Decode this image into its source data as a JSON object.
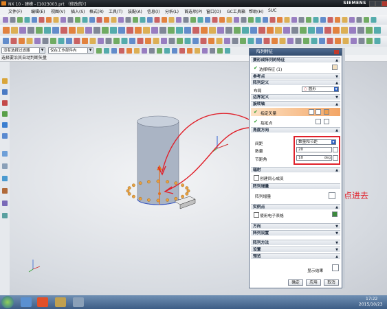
{
  "window": {
    "title": "NX 10 - 建模 - [1023003.prt （修改的）]",
    "brand": "SIEMENS"
  },
  "menu": [
    "文件(F)",
    "编辑(E)",
    "视图(V)",
    "插入(S)",
    "格式(R)",
    "工具(T)",
    "装配(A)",
    "信息(I)",
    "分析(L)",
    "首选项(P)",
    "窗口(O)",
    "GC工具箱",
    "帮助(H)",
    "SUC"
  ],
  "selection_bar": {
    "filter": "没有选择过滤器",
    "scope": "仅在工作部件内"
  },
  "cue_line": "选择要沿其自动判断矢量",
  "dialog": {
    "title": "阵列特征",
    "sec_features": "要形成阵列的特征",
    "select_feature": "选择特征 (1)",
    "sec_ref_point": "参考点",
    "sec_pattern_def": "阵列定义",
    "layout_label": "布局",
    "layout_value": "圆形",
    "sec_boundary": "边界定义",
    "sec_rotation_axis": "旋转轴",
    "specify_vector": "指定矢量",
    "specify_point": "指定点",
    "sec_angular_dir": "角度方向",
    "spacing_label": "间距",
    "spacing_value": "数量和节距",
    "count_label": "数量",
    "count_value": "20",
    "pitch_label": "节距角",
    "pitch_value": "10",
    "pitch_unit": "deg",
    "sec_radiate": "辐射",
    "create_concentric": "创建同心成员",
    "sec_pattern_fill": "阵列增量",
    "pattern_increment": "阵列增量",
    "sec_instance_points": "实例点",
    "use_spreadsheet": "使用电子表格",
    "sec_orientation": "方向",
    "sec_pattern_settings": "阵列设置",
    "sec_pattern_method": "阵列方法",
    "sec_settings": "设置",
    "sec_preview": "预览",
    "show_result": "显示结果",
    "ok": "确定",
    "apply": "应用",
    "cancel": "取消"
  },
  "annotation": "点进去",
  "clock": {
    "time": "17:22",
    "date": "2015/10/23"
  },
  "colors": {
    "title_bar": "#1b1f24",
    "dialog_caption": "#3e5a80",
    "highlight_orange": "#f0a050",
    "annotation_red": "#e0202a",
    "cylinder": "#aeb8c8"
  }
}
